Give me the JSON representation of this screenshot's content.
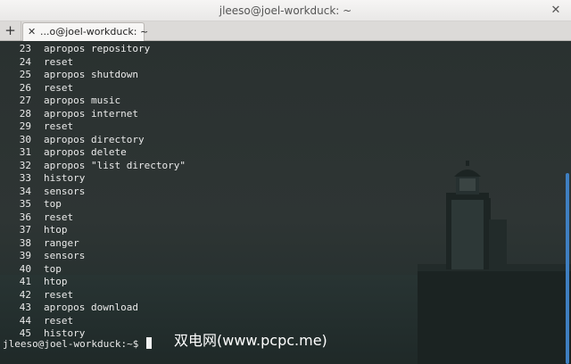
{
  "window": {
    "title": "jleeso@joel-workduck: ~",
    "close_glyph": "✕"
  },
  "tabbar": {
    "new_tab_glyph": "+",
    "tab_close_glyph": "✕",
    "tabs": [
      {
        "label": "...o@joel-workduck: ~"
      }
    ]
  },
  "terminal": {
    "history": [
      {
        "n": "23",
        "cmd": "apropos repository"
      },
      {
        "n": "24",
        "cmd": "reset"
      },
      {
        "n": "25",
        "cmd": "apropos shutdown"
      },
      {
        "n": "26",
        "cmd": "reset"
      },
      {
        "n": "27",
        "cmd": "apropos music"
      },
      {
        "n": "28",
        "cmd": "apropos internet"
      },
      {
        "n": "29",
        "cmd": "reset"
      },
      {
        "n": "30",
        "cmd": "apropos directory"
      },
      {
        "n": "31",
        "cmd": "apropos delete"
      },
      {
        "n": "32",
        "cmd": "apropos \"list directory\""
      },
      {
        "n": "33",
        "cmd": "history"
      },
      {
        "n": "34",
        "cmd": "sensors"
      },
      {
        "n": "35",
        "cmd": "top"
      },
      {
        "n": "36",
        "cmd": "reset"
      },
      {
        "n": "37",
        "cmd": "htop"
      },
      {
        "n": "38",
        "cmd": "ranger"
      },
      {
        "n": "39",
        "cmd": "sensors"
      },
      {
        "n": "40",
        "cmd": "top"
      },
      {
        "n": "41",
        "cmd": "htop"
      },
      {
        "n": "42",
        "cmd": "reset"
      },
      {
        "n": "43",
        "cmd": "apropos download"
      },
      {
        "n": "44",
        "cmd": "reset"
      },
      {
        "n": "45",
        "cmd": "history"
      }
    ],
    "prompt": "jleeso@joel-workduck:~$",
    "watermark": "双电网(www.pcpc.me)",
    "colors": {
      "text": "#eaeaea",
      "scrollbar": "#3f7fc1"
    }
  }
}
